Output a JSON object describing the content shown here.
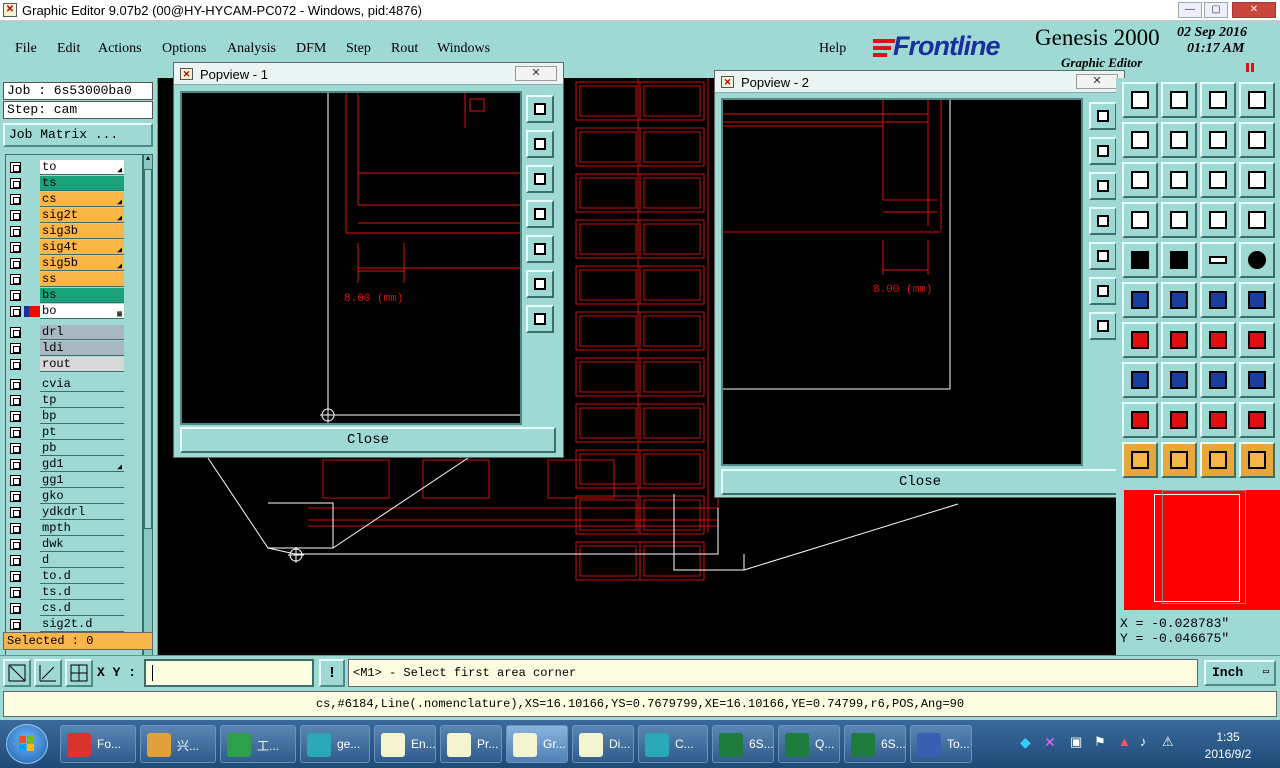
{
  "window": {
    "title": "Graphic Editor 9.07b2 (00@HY-HYCAM-PC072 - Windows, pid:4876)",
    "min_label": "—",
    "max_label": "▢",
    "close_label": "✕"
  },
  "menu": [
    "File",
    "Edit",
    "Actions",
    "Options",
    "Analysis",
    "DFM",
    "Step",
    "Rout",
    "Windows"
  ],
  "help": "Help",
  "brand": {
    "logo": "Frontline",
    "product": "Genesis 2000",
    "subtitle": "Graphic Editor",
    "date": "02 Sep 2016",
    "time": "01:17 AM"
  },
  "job": {
    "job_label": "Job : 6s53000ba0",
    "step_label": "Step: cam",
    "matrix_button": "Job Matrix ..."
  },
  "layers": {
    "group1": [
      {
        "name": "to",
        "color": "#ffffff",
        "mark": "◢"
      },
      {
        "name": "ts",
        "color": "#1aa37a",
        "mark": ""
      },
      {
        "name": "cs",
        "color": "#f7b54a",
        "mark": "◢"
      },
      {
        "name": "sig2t",
        "color": "#f7b54a",
        "mark": "◢"
      },
      {
        "name": "sig3b",
        "color": "#f7b54a",
        "mark": ""
      },
      {
        "name": "sig4t",
        "color": "#f7b54a",
        "mark": "◢"
      },
      {
        "name": "sig5b",
        "color": "#f7b54a",
        "mark": "◢"
      },
      {
        "name": "ss",
        "color": "#f7b54a",
        "mark": ""
      },
      {
        "name": "bs",
        "color": "#1aa37a",
        "mark": ""
      },
      {
        "name": "bo",
        "color": "#ffffff",
        "mark": "▦"
      }
    ],
    "group2": [
      {
        "name": "drl",
        "color": "#a9b8c0"
      },
      {
        "name": "ldi",
        "color": "#a9b8c0"
      },
      {
        "name": "rout",
        "color": "#d8d8d8"
      }
    ],
    "group3": [
      "cvia",
      "tp",
      "bp",
      "pt",
      "pb",
      "gd1",
      "gg1",
      "gko",
      "ydkdrl",
      "mpth",
      "dwk",
      "d",
      "to.d",
      "ts.d",
      "cs.d",
      "sig2t.d"
    ],
    "group3_marks": {
      "gd1": "◢",
      "to.d": "◢",
      "cs.d": "◢"
    },
    "selected": "Selected : 0"
  },
  "popups": [
    {
      "title": "Popview - 1",
      "close_label": "Close",
      "close_x": "✕",
      "measure": "8.00 (mm)"
    },
    {
      "title": "Popview - 2",
      "close_label": "Close",
      "close_x": "✕",
      "measure": "8.00 (mm)"
    }
  ],
  "coords": {
    "x": "X = -0.028783\"",
    "y": "Y = -0.046675\""
  },
  "command": {
    "xy_label": "X Y :",
    "input_value": "",
    "prompt": "<M1> - Select first area corner",
    "units": "Inch"
  },
  "status": "cs,#6184,Line(.nomenclature),XS=16.10166,YS=0.7679799,XE=16.10166,YE=0.74799,r6,POS,Ang=90",
  "taskbar": {
    "items": [
      {
        "label": "Fo...",
        "color": "#d9342b"
      },
      {
        "label": "兴...",
        "color": "#e2a03a"
      },
      {
        "label": "工...",
        "color": "#2fa04a"
      },
      {
        "label": "ge...",
        "color": "#2aa8b8"
      },
      {
        "label": "En...",
        "color": "#f4f4d0"
      },
      {
        "label": "Pr...",
        "color": "#f4f4d0"
      },
      {
        "label": "Gr...",
        "color": "#f4f4d0"
      },
      {
        "label": "Di...",
        "color": "#f4f4d0"
      },
      {
        "label": "C...",
        "color": "#2aa8b8"
      },
      {
        "label": "6S...",
        "color": "#1f7a3d"
      },
      {
        "label": "Q...",
        "color": "#1f7a3d"
      },
      {
        "label": "6S...",
        "color": "#1f7a3d"
      },
      {
        "label": "To...",
        "color": "#3a5fb0"
      }
    ],
    "time": "1:35",
    "date": "2016/9/2"
  },
  "colors": {
    "panel": "#9fd9d4",
    "accent_red": "#ff0000",
    "trace_red": "#cc1010"
  }
}
